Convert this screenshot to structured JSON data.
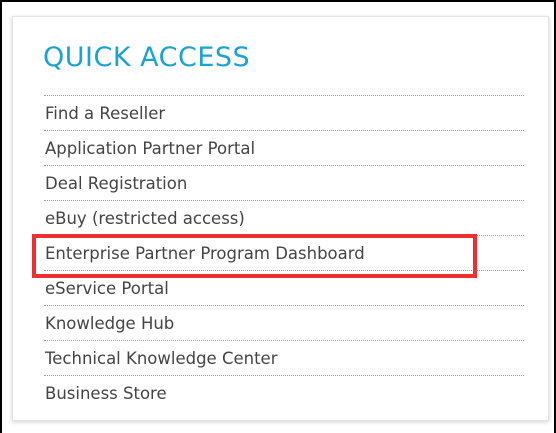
{
  "quick_access": {
    "title": "QUICK ACCESS",
    "items": [
      {
        "label": "Find a Reseller"
      },
      {
        "label": "Application Partner Portal"
      },
      {
        "label": "Deal Registration"
      },
      {
        "label": "eBuy (restricted access)"
      },
      {
        "label": "Enterprise Partner Program Dashboard"
      },
      {
        "label": "eService Portal"
      },
      {
        "label": "Knowledge Hub"
      },
      {
        "label": "Technical Knowledge Center"
      },
      {
        "label": "Business Store"
      }
    ]
  },
  "colors": {
    "title": "#1aa3cf",
    "link": "#444444",
    "highlight_border": "#ef2f2f"
  }
}
